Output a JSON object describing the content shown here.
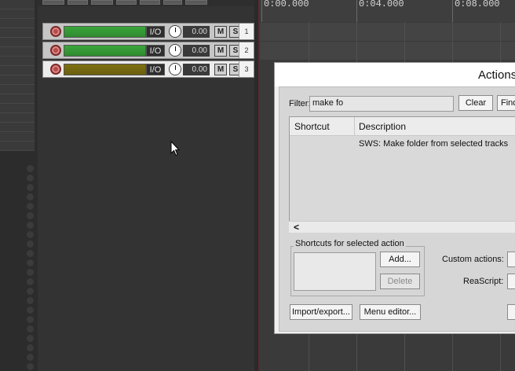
{
  "tracks": [
    {
      "number": "1",
      "io_label": "I/O",
      "volume": "0.00",
      "mute": "M",
      "solo": "S"
    },
    {
      "number": "2",
      "io_label": "I/O",
      "volume": "0.00",
      "mute": "M",
      "solo": "S"
    },
    {
      "number": "3",
      "io_label": "I/O",
      "volume": "0.00",
      "mute": "M",
      "solo": "S"
    }
  ],
  "ruler": {
    "labels": [
      "0:00.000",
      "0:04.000",
      "0:08.000"
    ]
  },
  "actions_dialog": {
    "title": "Actions",
    "filter_label": "Filter:",
    "filter_value": "make fo",
    "clear_button": "Clear",
    "find_button": "Find",
    "columns": [
      "Shortcut",
      "Description"
    ],
    "rows": [
      {
        "shortcut": "",
        "description": "SWS: Make folder from selected tracks"
      }
    ],
    "scroll_left": "<",
    "shortcuts_group": "Shortcuts for selected action",
    "add_button": "Add...",
    "delete_button": "Delete",
    "custom_actions_label": "Custom actions:",
    "reascript_label": "ReaScript:",
    "import_export_button": "Import/export...",
    "menu_editor_button": "Menu editor..."
  },
  "colors": {
    "track_green": "#3aa63a",
    "track_olive": "#7e7012",
    "record_red": "#b74a4a"
  }
}
